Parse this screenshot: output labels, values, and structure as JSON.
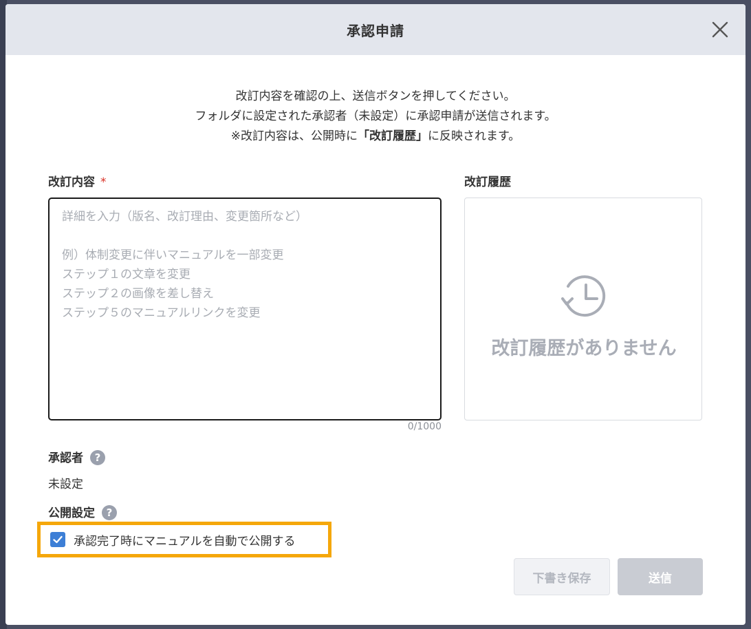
{
  "modal": {
    "title": "承認申請",
    "close_icon": "close-icon"
  },
  "intro": {
    "line1": "改訂内容を確認の上、送信ボタンを押してください。",
    "line2": "フォルダに設定された承認者（未設定）に承認申請が送信されます。",
    "line3_prefix": "※改訂内容は、公開時に",
    "line3_bold": "「改訂履歴」",
    "line3_suffix": "に反映されます。"
  },
  "revision": {
    "label": "改訂内容",
    "required_mark": "*",
    "value": "",
    "placeholder": "詳細を入力（版名、改訂理由、変更箇所など）\n\n例）体制変更に伴いマニュアルを一部変更\nステップ１の文章を変更\nステップ２の画像を差し替え\nステップ５のマニュアルリンクを変更",
    "char_count": "0/1000"
  },
  "history": {
    "label": "改訂履歴",
    "icon": "history-clock-icon",
    "empty_text": "改訂履歴がありません"
  },
  "approver": {
    "label": "承認者",
    "help_icon": "help-icon",
    "help_glyph": "?",
    "value": "未設定"
  },
  "publish": {
    "label": "公開設定",
    "help_icon": "help-icon",
    "help_glyph": "?",
    "checkbox_label": "承認完了時にマニュアルを自動で公開する",
    "checked": true,
    "highlight_color": "#f5a70a"
  },
  "buttons": {
    "draft_label": "下書き保存",
    "send_label": "送信"
  },
  "colors": {
    "header_bg": "#e3e6ed",
    "required": "#d93025",
    "checkbox": "#3d7fd6",
    "disabled_button": "#c9ccd3"
  }
}
